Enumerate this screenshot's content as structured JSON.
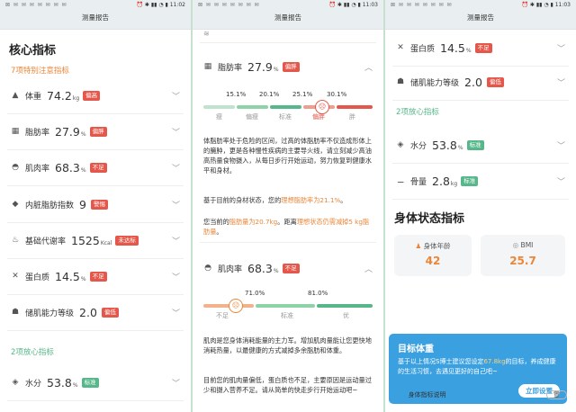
{
  "status": {
    "time_left": "11:02",
    "time_mid": "11:03",
    "time_right": "11:03",
    "left_icons": "⊠ ✉ ✉ ✉ ✉ ✉ ✉ ✉",
    "right_icons": "⏰ ✱ ▮▮ ◔ ▮"
  },
  "title": "测量报告",
  "p1": {
    "section_title": "核心指标",
    "attention_label": "7项特别注意指标",
    "normal_label": "2项放心指标",
    "rows": [
      {
        "icon": "▲",
        "name": "体重",
        "value": "74.2",
        "unit": "kg",
        "badge": "偏高",
        "badge_color": "red"
      },
      {
        "icon": "▦",
        "name": "脂肪率",
        "value": "27.9",
        "unit": "%",
        "badge": "偏胖",
        "badge_color": "red"
      },
      {
        "icon": "◓",
        "name": "肌肉率",
        "value": "68.3",
        "unit": "%",
        "badge": "不足",
        "badge_color": "red"
      },
      {
        "icon": "◆",
        "name": "内脏脂肪指数",
        "value": "9",
        "unit": "",
        "badge": "警惕",
        "badge_color": "red"
      },
      {
        "icon": "♨",
        "name": "基础代谢率",
        "value": "1525",
        "unit": "Kcal",
        "badge": "未达标",
        "badge_color": "red"
      },
      {
        "icon": "✕",
        "name": "蛋白质",
        "value": "14.5",
        "unit": "%",
        "badge": "不足",
        "badge_color": "red"
      },
      {
        "icon": "☗",
        "name": "储肌能力等级",
        "value": "2.0",
        "unit": "",
        "badge": "偏低",
        "badge_color": "red"
      },
      {
        "icon": "◈",
        "name": "水分",
        "value": "53.8",
        "unit": "%",
        "badge": "标准",
        "badge_color": "green"
      }
    ]
  },
  "p2": {
    "top_partial": "≋",
    "fat": {
      "name": "脂肪率",
      "value": "27.9",
      "unit": "%",
      "badge": "偏胖",
      "ticks": [
        "15.1%",
        "20.1%",
        "25.1%",
        "30.1%"
      ],
      "zones": [
        "瘦",
        "偏瘦",
        "标准",
        "偏胖",
        "胖"
      ],
      "para1": "体脂肪率处于危险的区间，过高的体脂肪率不仅造成形体上的臃肿，更是各种慢性疾病的主要导火线，请立刻减少高油高热量食物摄入，从每日步行开始运动，努力恢复到健康水平和身材。",
      "para2_a": "基于目前的身材状态，您的",
      "para2_b": "理想脂肪率为21.1%",
      "para2_c": "。",
      "para3_a": "您当前的",
      "para3_b": "脂肪量为20.7kg",
      "para3_c": "。距离",
      "para3_d": "理想状态仍需减掉5 kg脂肪量",
      "para3_e": "。"
    },
    "muscle": {
      "name": "肌肉率",
      "value": "68.3",
      "unit": "%",
      "badge": "不足",
      "ticks": [
        "71.0%",
        "81.0%"
      ],
      "zones": [
        "不足",
        "标准",
        "优"
      ],
      "para1": "肌肉是您身体消耗能量的主力军。增加肌肉量能让您更快地消耗热量，以最健康的方式减掉多余脂肪和体重。",
      "para2": "目前您的肌肉量偏低，蛋白质也不足，主要原因是运动量过少和摄入营养不足。请从简单的快走步行开始运动吧~"
    }
  },
  "p3": {
    "rows_top": [
      {
        "icon": "✕",
        "name": "蛋白质",
        "value": "14.5",
        "unit": "%",
        "badge": "不足",
        "badge_color": "red"
      },
      {
        "icon": "☗",
        "name": "储肌能力等级",
        "value": "2.0",
        "unit": "",
        "badge": "偏低",
        "badge_color": "red"
      }
    ],
    "normal_label": "2项放心指标",
    "rows_normal": [
      {
        "icon": "◈",
        "name": "水分",
        "value": "53.8",
        "unit": "%",
        "badge": "标准",
        "badge_color": "green"
      },
      {
        "icon": "⚊",
        "name": "骨量",
        "value": "2.8",
        "unit": "kg",
        "badge": "标准",
        "badge_color": "green"
      }
    ],
    "body_title": "身体状态指标",
    "age_label": "身体年龄",
    "age_value": "42",
    "bmi_label": "BMI",
    "bmi_value": "25.7",
    "target_title": "目标体重",
    "target_text_a": "基于以上情况S博士建议您设定",
    "target_text_b": "67.8kg",
    "target_text_c": "的目标，养成健康的生活习惯，去遇见更好的自己吧~",
    "target_button": "立即设置",
    "footer_label": "身体指标说明"
  },
  "colors": {
    "red": "#e4574a",
    "orange": "#e98639",
    "green": "#56b78a",
    "blue": "#3aa0e0"
  }
}
